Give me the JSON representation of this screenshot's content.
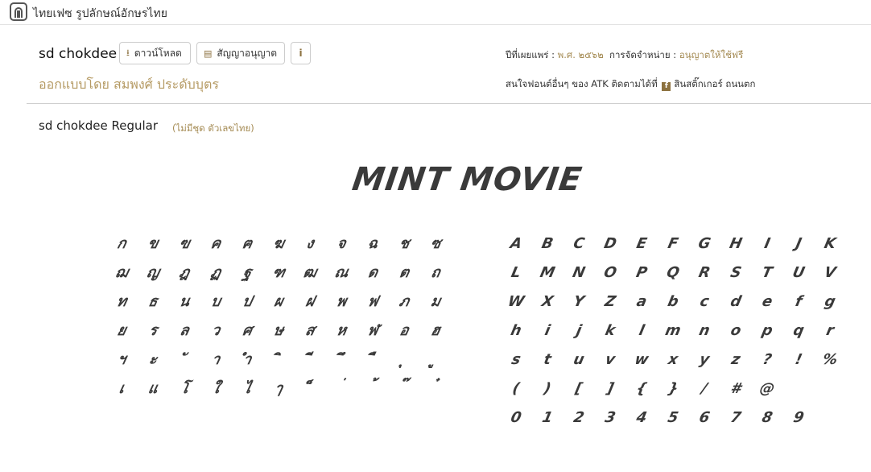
{
  "header": {
    "site_name": "ไทยเฟซ รูปลักษณ์อักษรไทย",
    "logo_icon": "thaifaces-logo-icon"
  },
  "font": {
    "name": "sd chokdee",
    "download_label": "ดาวน์โหลด",
    "license_label": "สัญญาอนุญาต",
    "info_label": "i",
    "designer": "ออกแบบโดย สมพงศ์ ประดับบุตร"
  },
  "meta": {
    "published_label": "ปีที่เผยแพร่ :",
    "published_value": "พ.ศ. ๒๕๖๒",
    "distribution_label": "การจัดจำหน่าย :",
    "distribution_value": "อนุญาตให้ใช้ฟรี",
    "more_fonts_text": "สนใจฟอนต์อื่นๆ ของ ATK ติดตามได้ที่",
    "facebook_icon": "f",
    "facebook_page": "สินสติ๊กเกอร์ ถนนตก"
  },
  "style": {
    "name": "sd chokdee Regular",
    "note": "(ไม่มีชุด ตัวเลขไทย)"
  },
  "sample_text": "MINT MOVIE",
  "thai_rows": [
    [
      "ก",
      "ข",
      "ฃ",
      "ค",
      "ฅ",
      "ฆ",
      "ง",
      "จ",
      "ฉ",
      "ช",
      "ซ"
    ],
    [
      "ฌ",
      "ญ",
      "ฎ",
      "ฏ",
      "ฐ",
      "ฑ",
      "ฒ",
      "ณ",
      "ด",
      "ต",
      "ถ"
    ],
    [
      "ท",
      "ธ",
      "น",
      "บ",
      "ป",
      "ผ",
      "ฝ",
      "พ",
      "ฟ",
      "ภ",
      "ม"
    ],
    [
      "ย",
      "ร",
      "ล",
      "ว",
      "ศ",
      "ษ",
      "ส",
      "ห",
      "ฬ",
      "อ",
      "ฮ"
    ],
    [
      "ฯ",
      "ะ",
      "ั",
      "า",
      "ำ",
      "ิ",
      "ี",
      "ึ",
      "ื",
      "ุ",
      "ู"
    ],
    [
      "เ",
      "แ",
      "โ",
      "ใ",
      "ไ",
      "ๅ",
      "็",
      "่",
      "้",
      "๊",
      "๋"
    ]
  ],
  "latin_rows": [
    [
      "A",
      "B",
      "C",
      "D",
      "E",
      "F",
      "G",
      "H",
      "I",
      "J",
      "K"
    ],
    [
      "L",
      "M",
      "N",
      "O",
      "P",
      "Q",
      "R",
      "S",
      "T",
      "U",
      "V"
    ],
    [
      "W",
      "X",
      "Y",
      "Z",
      "a",
      "b",
      "c",
      "d",
      "e",
      "f",
      "g"
    ],
    [
      "h",
      "i",
      "j",
      "k",
      "l",
      "m",
      "n",
      "o",
      "p",
      "q",
      "r"
    ],
    [
      "s",
      "t",
      "u",
      "v",
      "w",
      "x",
      "y",
      "z",
      "?",
      "!",
      "%"
    ],
    [
      "(",
      ")",
      "[",
      "]",
      "{",
      "}",
      "/",
      "#",
      "@"
    ],
    [
      "0",
      "1",
      "2",
      "3",
      "4",
      "5",
      "6",
      "7",
      "8",
      "9"
    ]
  ]
}
